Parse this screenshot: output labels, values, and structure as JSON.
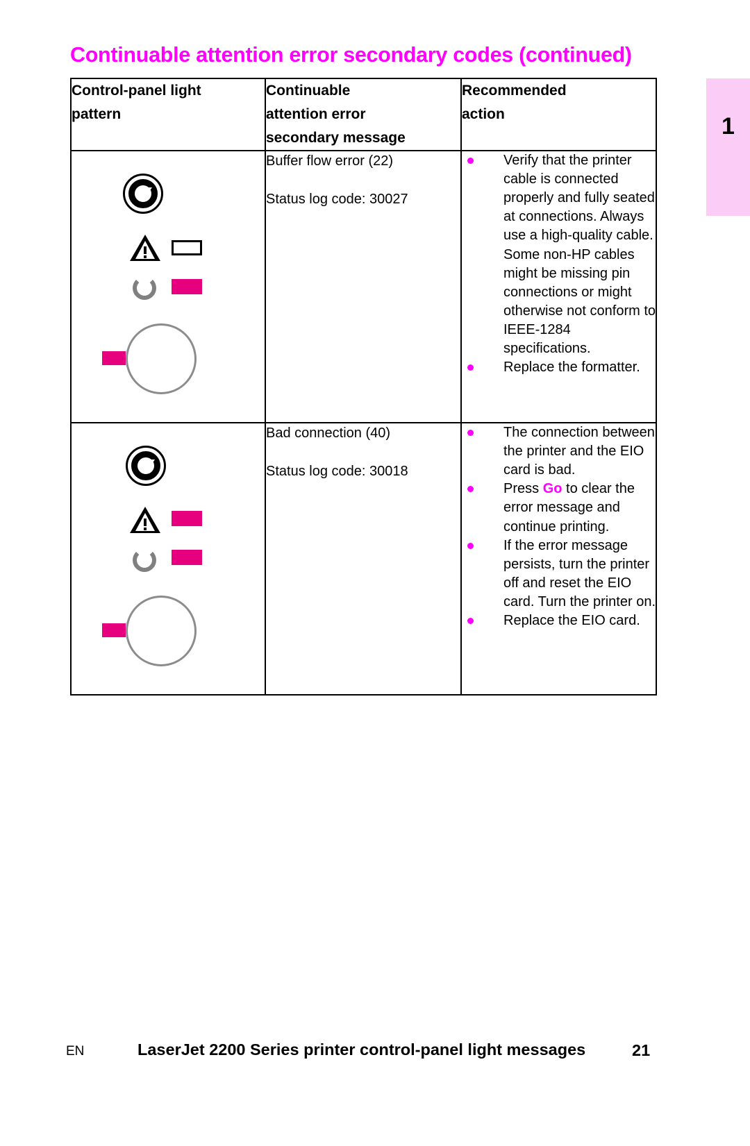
{
  "page": {
    "title": "Continuable attention error secondary codes (continued)",
    "title_color": "#ff00ff",
    "chapter_tab": {
      "number": "1",
      "color": "#fbcdf6"
    }
  },
  "table": {
    "headers": [
      {
        "lines": [
          "Control-panel light",
          "pattern"
        ]
      },
      {
        "lines": [
          "Continuable",
          "attention error",
          "secondary message"
        ]
      },
      {
        "lines": [
          "Recommended",
          "action"
        ]
      }
    ],
    "rows": [
      {
        "pattern": {
          "name": "control-panel-light-pattern-buffer-flow-error",
          "go_round_icon": "go-triangle-icon",
          "attention_icon": "attention-triangle-icon",
          "attention_led": "off",
          "ready_icon": "ready-circle-icon",
          "ready_led": "on",
          "button_led": "on",
          "led_on_color": "#e6007e"
        },
        "message": {
          "line1": "Buffer flow error (22)",
          "line2": "Status log code: 30027"
        },
        "actions": [
          "Verify that the printer cable is connected properly and fully seated at connections. Always use a high-quality cable. Some non-HP cables might be missing pin connections or might otherwise not conform to IEEE-1284 specifications.",
          "Replace the formatter."
        ]
      },
      {
        "pattern": {
          "name": "control-panel-light-pattern-bad-connection",
          "go_round_icon": "go-triangle-icon",
          "attention_icon": "attention-triangle-icon",
          "attention_led": "on",
          "ready_icon": "ready-circle-icon",
          "ready_led": "on",
          "button_led": "on",
          "led_on_color": "#e6007e"
        },
        "message": {
          "line1": "Bad connection (40)",
          "line2": "Status log code: 30018"
        },
        "actions": [
          "The connection between the printer and the EIO card is bad.",
          {
            "pre": "Press ",
            "highlight": "Go",
            "post": " to clear the error message and continue printing."
          },
          "If the error message persists, turn the printer off and reset the EIO card. Turn the printer on.",
          "Replace the EIO card."
        ]
      }
    ]
  },
  "footer": {
    "language": "EN",
    "title": "LaserJet 2200 Series printer control-panel light messages",
    "page_number": "21"
  }
}
